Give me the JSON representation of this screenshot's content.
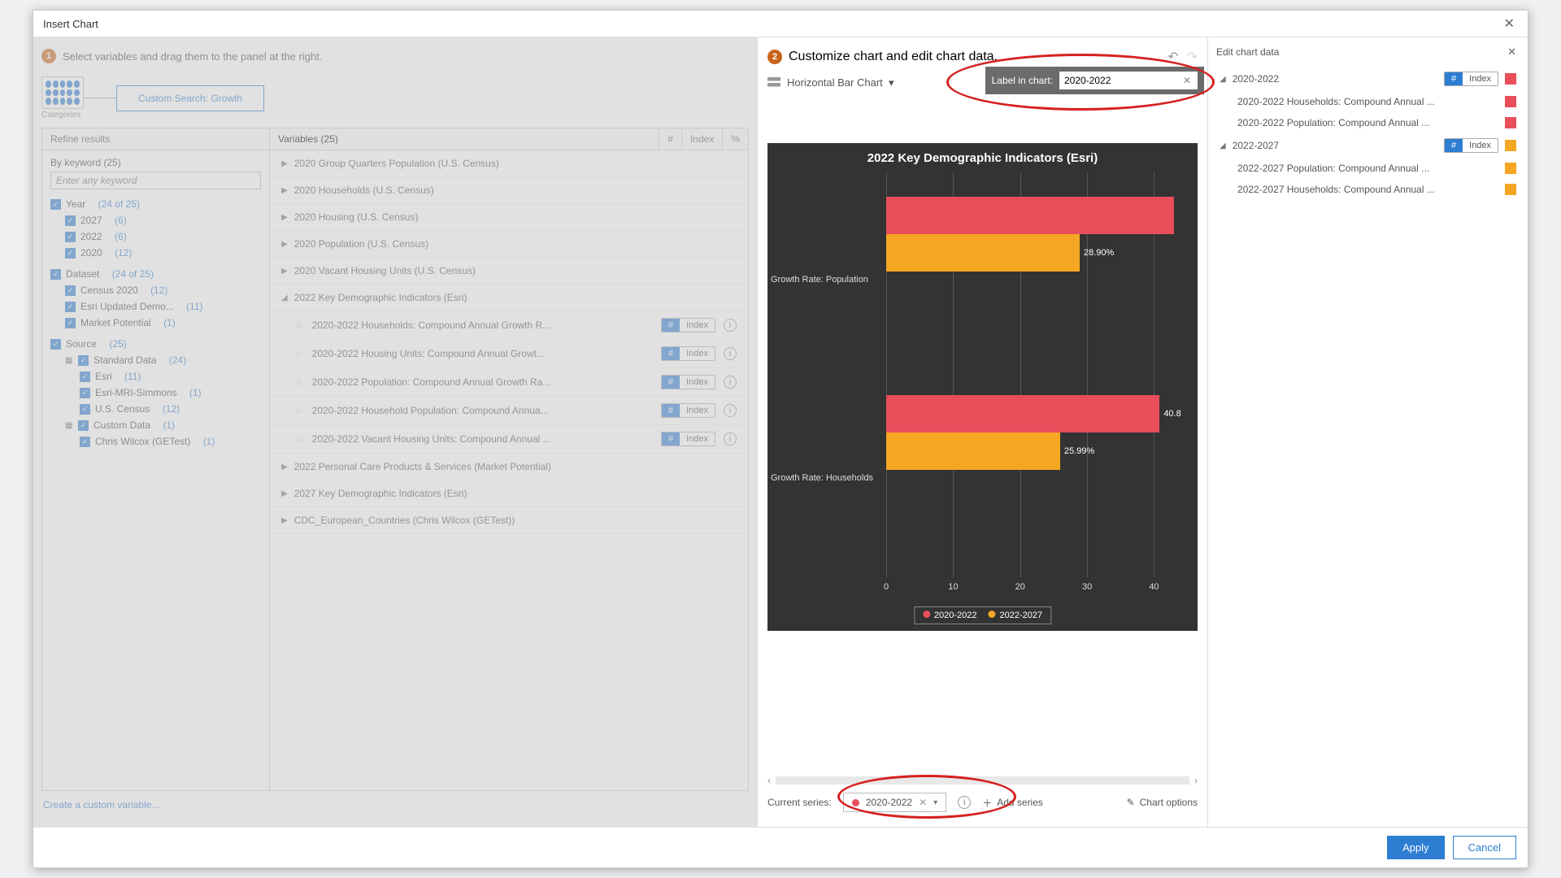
{
  "modal_title": "Insert Chart",
  "step1_text": "Select variables and drag them to the panel at the right.",
  "step2_text": "Customize chart and edit chart data.",
  "categories_label": "Categories",
  "search_pill": "Custom Search: Growth",
  "refine_header": "Refine results",
  "vars_header": "Variables (25)",
  "mini": {
    "hash": "#",
    "index": "Index",
    "pct": "%"
  },
  "keyword": {
    "label": "By keyword  (25)",
    "placeholder": "Enter any keyword"
  },
  "filters": {
    "year": {
      "label": "Year",
      "count": "(24 of 25)"
    },
    "y2027": {
      "label": "2027",
      "count": "(6)"
    },
    "y2022": {
      "label": "2022",
      "count": "(6)"
    },
    "y2020": {
      "label": "2020",
      "count": "(12)"
    },
    "dataset": {
      "label": "Dataset",
      "count": "(24 of 25)"
    },
    "census": {
      "label": "Census 2020",
      "count": "(12)"
    },
    "esri_upd": {
      "label": "Esri Updated Demo...",
      "count": "(11)"
    },
    "mp": {
      "label": "Market Potential",
      "count": "(1)"
    },
    "source": {
      "label": "Source",
      "count": "(25)"
    },
    "std": {
      "label": "Standard Data",
      "count": "(24)"
    },
    "esri": {
      "label": "Esri",
      "count": "(11)"
    },
    "mri": {
      "label": "Esri-MRI-Simmons",
      "count": "(1)"
    },
    "usc": {
      "label": "U.S. Census",
      "count": "(12)"
    },
    "custom": {
      "label": "Custom Data",
      "count": "(1)"
    },
    "cw": {
      "label": "Chris Wilcox (GETest)",
      "count": "(1)"
    }
  },
  "groups": {
    "g1": "2020 Group Quarters Population (U.S. Census)",
    "g2": "2020 Households (U.S. Census)",
    "g3": "2020 Housing (U.S. Census)",
    "g4": "2020 Population (U.S. Census)",
    "g5": "2020 Vacant Housing Units (U.S. Census)",
    "g6": "2022 Key Demographic Indicators (Esri)",
    "g7": "2022 Personal Care Products & Services (Market Potential)",
    "g8": "2027 Key Demographic Indicators (Esri)",
    "g9": "CDC_European_Countries (Chris Wilcox (GETest))"
  },
  "items": {
    "i1": "2020-2022 Households: Compound Annual Growth R...",
    "i2": "2020-2022 Housing Units: Compound Annual Growt...",
    "i3": "2020-2022 Population: Compound Annual Growth Ra...",
    "i4": "2020-2022 Household Population: Compound Annua...",
    "i5": "2020-2022 Vacant Housing Units: Compound Annual ..."
  },
  "pill_index": "Index",
  "create_link": "Create a custom variable...",
  "chart_type": "Horizontal Bar Chart",
  "label_in_chart_label": "Label in chart:",
  "label_in_chart_value": "2020-2022",
  "chart_data": {
    "type": "bar",
    "orientation": "horizontal",
    "title": "2022 Key Demographic Indicators (Esri)",
    "categories": [
      "Growth Rate: Population",
      "Growth Rate: Households"
    ],
    "series": [
      {
        "name": "2020-2022",
        "color": "#e94e5b",
        "values": [
          43.0,
          40.8
        ]
      },
      {
        "name": "2022-2027",
        "color": "#f5a623",
        "values": [
          28.9,
          25.99
        ]
      }
    ],
    "value_labels": {
      "s0c1": "40.8",
      "s1c0": "28.90%",
      "s1c1": "25.99%"
    },
    "x_ticks": [
      "0",
      "10",
      "20",
      "30",
      "40"
    ],
    "xlim": [
      0,
      45
    ]
  },
  "current_series_label": "Current series:",
  "current_series_value": "2020-2022",
  "add_series": "Add series",
  "chart_options": "Chart options",
  "edit_header": "Edit chart data",
  "tree": {
    "n1": "2020-2022",
    "n1a": "2020-2022 Households: Compound Annual ...",
    "n1b": "2020-2022 Population: Compound Annual ...",
    "n2": "2022-2027",
    "n2a": "2022-2027 Population: Compound Annual ...",
    "n2b": "2022-2027 Households: Compound Annual ..."
  },
  "apply": "Apply",
  "cancel": "Cancel"
}
